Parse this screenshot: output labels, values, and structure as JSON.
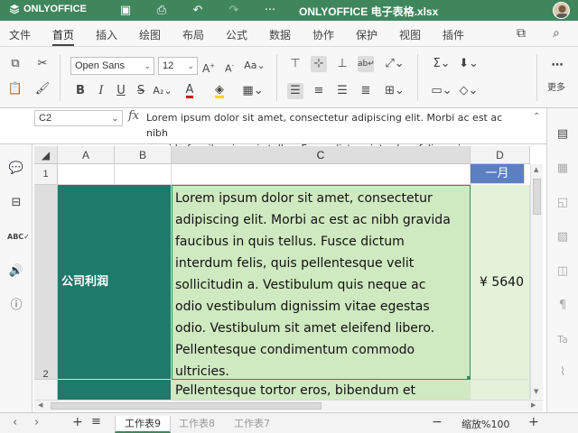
{
  "app": {
    "brand": "ONLYOFFICE",
    "doc_title": "ONLYOFFICE 电子表格.xlsx"
  },
  "colors": {
    "titlebar": "#40865c",
    "teal_cell": "#1e7a6a",
    "green_cell": "#cfe9c0",
    "month_header": "#5b7fc0"
  },
  "menu": {
    "tabs": [
      "文件",
      "首页",
      "插入",
      "绘图",
      "布局",
      "公式",
      "数据",
      "协作",
      "保护",
      "视图",
      "插件"
    ],
    "active": "首页"
  },
  "ribbon": {
    "font_name": "Open Sans",
    "font_size": "12",
    "more_label": "更多"
  },
  "formula": {
    "cell_ref": "C2",
    "fx": "fx",
    "line1": "Lorem ipsum dolor sit amet, consectetur adipiscing elit. Morbi ac est ac nibh",
    "line2": "gravida faucibus in quis tellus. Fusce dictum interdum felis, quis"
  },
  "grid": {
    "columns": [
      "A",
      "B",
      "C",
      "D"
    ],
    "rows": [
      "1",
      "2"
    ],
    "d1": "一月",
    "a2": "公司利润",
    "c2_lines": [
      "Lorem ipsum dolor sit amet, consectetur",
      "adipiscing elit. Morbi ac est ac nibh gravida",
      "faucibus in quis tellus. Fusce dictum",
      "interdum felis, quis pellentesque velit",
      "sollicitudin a. Vestibulum quis neque ac",
      "odio vestibulum dignissim vitae egestas",
      "odio. Vestibulum sit amet eleifend libero.",
      "Pellentesque condimentum commodo",
      "ultricies."
    ],
    "d2": "¥ 5640",
    "c3": "Pellentesque tortor eros, bibendum et"
  },
  "status": {
    "sheets": [
      "工作表9",
      "工作表8",
      "工作表7"
    ],
    "active_sheet": "工作表9",
    "zoom": "缩放%100"
  }
}
